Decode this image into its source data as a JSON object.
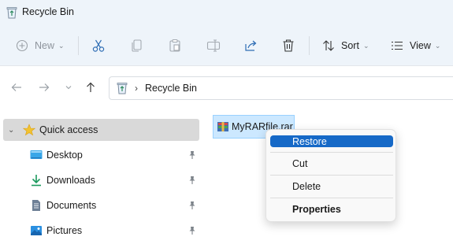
{
  "window": {
    "title": "Recycle Bin",
    "icon": "recycle-bin-icon"
  },
  "toolbar": {
    "new_label": "New",
    "sort_label": "Sort",
    "view_label": "View",
    "icons": [
      "new-icon",
      "cut-icon",
      "copy-icon",
      "paste-icon",
      "rename-icon",
      "share-icon",
      "delete-icon",
      "sort-icon",
      "view-icon"
    ]
  },
  "navigation": {
    "address_separator": "›",
    "address_location": "Recycle Bin"
  },
  "sidebar": {
    "items": [
      {
        "label": "Quick access",
        "icon": "star-icon"
      },
      {
        "label": "Desktop",
        "icon": "desktop-icon",
        "pinned": true
      },
      {
        "label": "Downloads",
        "icon": "download-icon",
        "pinned": true
      },
      {
        "label": "Documents",
        "icon": "documents-icon",
        "pinned": true
      },
      {
        "label": "Pictures",
        "icon": "pictures-icon",
        "pinned": true
      }
    ]
  },
  "content": {
    "files": [
      {
        "name": "MyRARfile.rar",
        "icon": "rar-archive-icon",
        "selected": true
      }
    ]
  },
  "context_menu": {
    "items": [
      {
        "label": "Restore"
      },
      {
        "label": "Cut"
      },
      {
        "label": "Delete"
      },
      {
        "label": "Properties"
      }
    ]
  },
  "colors": {
    "menu_highlight": "#1669c7",
    "selection_fill": "#cce8ff",
    "title_background": "#eef4fa"
  }
}
